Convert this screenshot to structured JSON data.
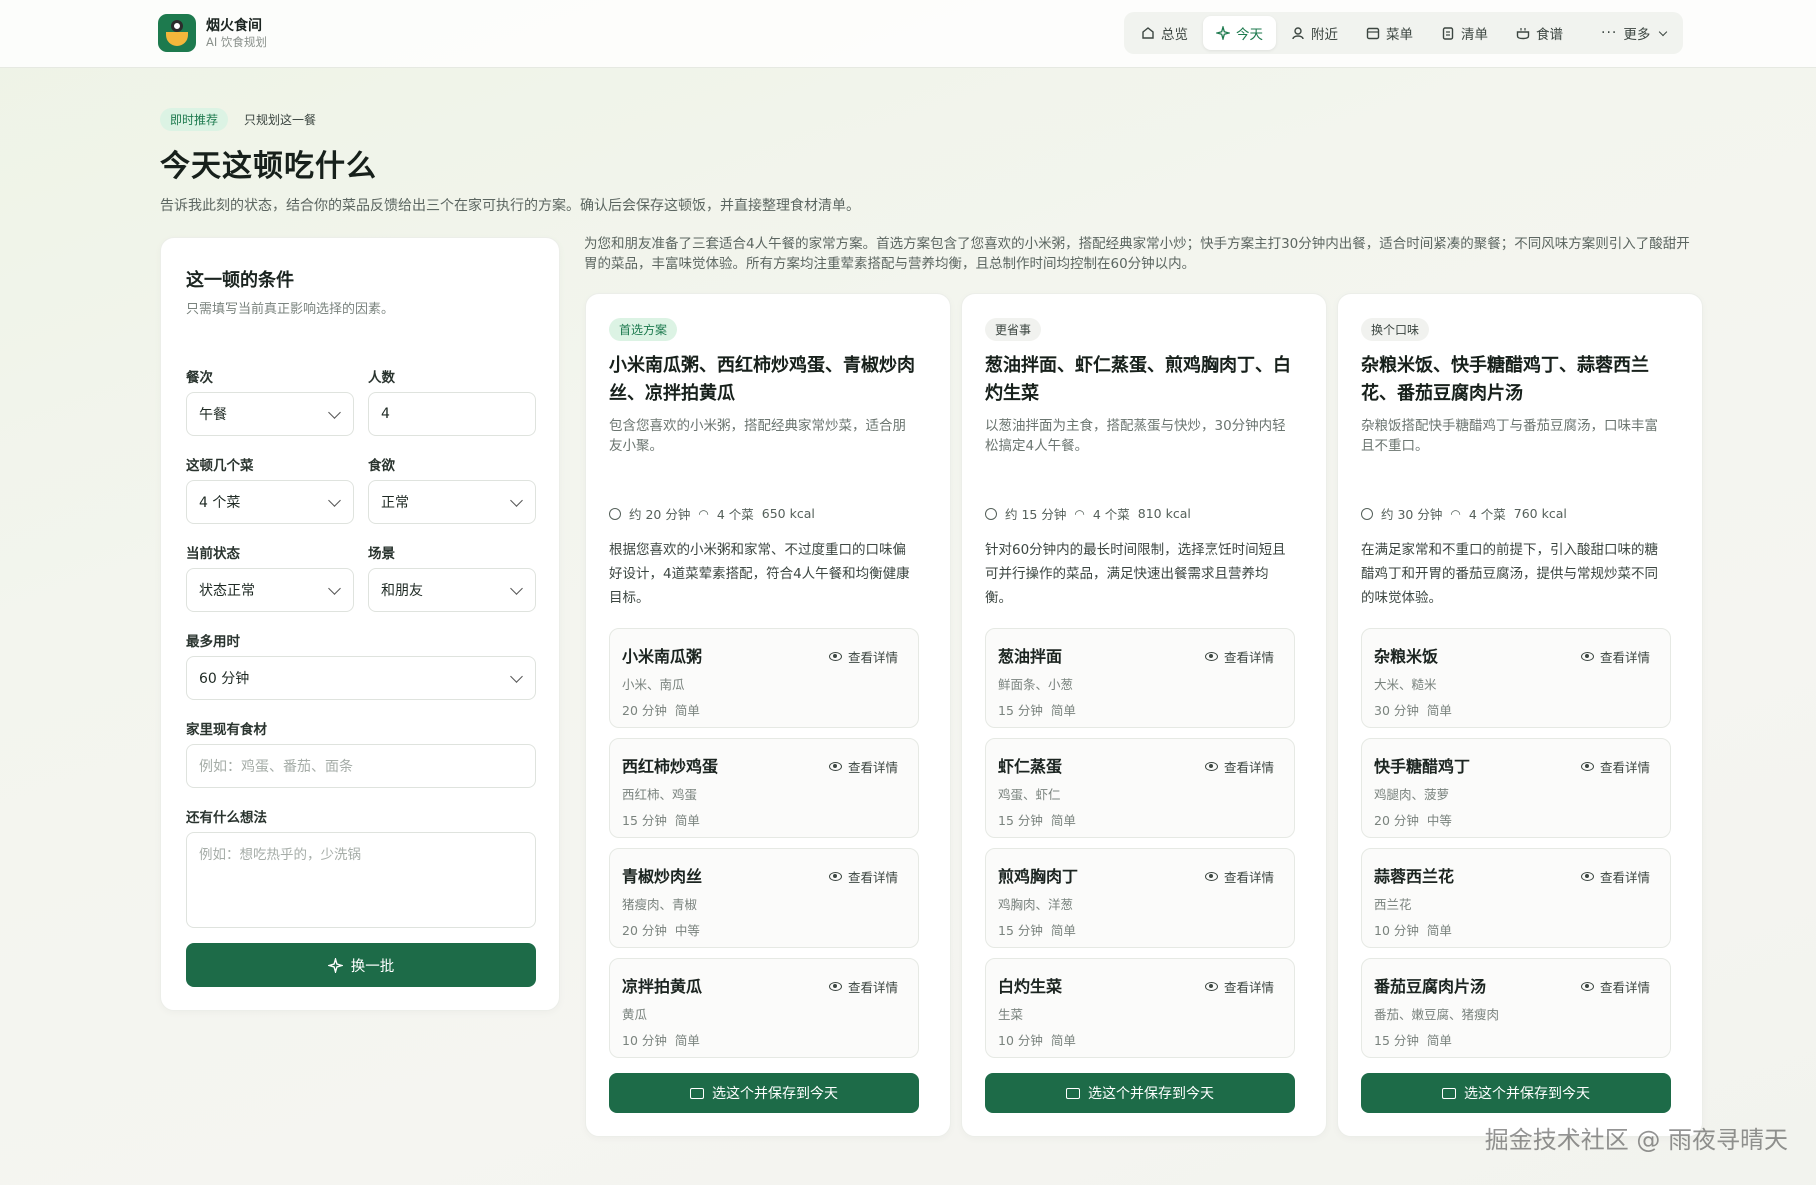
{
  "brand": {
    "name": "烟火食间",
    "sub": "AI 饮食规划"
  },
  "nav": [
    {
      "label": "总览",
      "icon": "home-icon",
      "active": false
    },
    {
      "label": "今天",
      "icon": "sparkle-icon",
      "active": true
    },
    {
      "label": "附近",
      "icon": "person-icon",
      "active": false
    },
    {
      "label": "菜单",
      "icon": "calendar-icon",
      "active": false
    },
    {
      "label": "清单",
      "icon": "clipboard-icon",
      "active": false
    },
    {
      "label": "食谱",
      "icon": "cookpot-icon",
      "active": false
    },
    {
      "label": "更多",
      "icon": "more-icon",
      "active": false
    }
  ],
  "hero": {
    "tag": "即时推荐",
    "tag2": "只规划这一餐",
    "title": "今天这顿吃什么",
    "desc": "告诉我此刻的状态，结合你的菜品反馈给出三个在家可执行的方案。确认后会保存这顿饭，并直接整理食材清单。"
  },
  "conditions": {
    "title": "这一顿的条件",
    "sub": "只需填写当前真正影响选择的因素。",
    "meal_label": "餐次",
    "meal_value": "午餐",
    "people_label": "人数",
    "people_value": "4",
    "dishes_label": "这顿几个菜",
    "dishes_value": "4 个菜",
    "appetite_label": "食欲",
    "appetite_value": "正常",
    "state_label": "当前状态",
    "state_value": "状态正常",
    "scene_label": "场景",
    "scene_value": "和朋友",
    "time_label": "最多用时",
    "time_value": "60 分钟",
    "ingredients_label": "家里现有食材",
    "ingredients_placeholder": "例如：鸡蛋、番茄、面条",
    "ideas_label": "还有什么想法",
    "ideas_placeholder": "例如：想吃热乎的，少洗锅",
    "refresh_button": "换一批"
  },
  "summary": "为您和朋友准备了三套适合4人午餐的家常方案。首选方案包含了您喜欢的小米粥，搭配经典家常小炒；快手方案主打30分钟内出餐，适合时间紧凑的聚餐；不同风味方案则引入了酸甜开胃的菜品，丰富味觉体验。所有方案均注重荤素搭配与营养均衡，且总制作时间均控制在60分钟以内。",
  "plans": [
    {
      "tag": "首选方案",
      "title": "小米南瓜粥、西红柿炒鸡蛋、青椒炒肉丝、凉拌拍黄瓜",
      "desc": "包含您喜欢的小米粥，搭配经典家常炒菜，适合朋友小聚。",
      "time": "约 20 分钟",
      "count": "4 个菜",
      "kcal": "650 kcal",
      "reason": "根据您喜欢的小米粥和家常、不过度重口的口味偏好设计，4道菜荤素搭配，符合4人午餐和均衡健康目标。",
      "dishes": [
        {
          "name": "小米南瓜粥",
          "ing": "小米、南瓜",
          "time": "20 分钟",
          "level": "简单"
        },
        {
          "name": "西红柿炒鸡蛋",
          "ing": "西红柿、鸡蛋",
          "time": "15 分钟",
          "level": "简单"
        },
        {
          "name": "青椒炒肉丝",
          "ing": "猪瘦肉、青椒",
          "time": "20 分钟",
          "level": "中等"
        },
        {
          "name": "凉拌拍黄瓜",
          "ing": "黄瓜",
          "time": "10 分钟",
          "level": "简单"
        }
      ],
      "detail": "查看详情",
      "button": "选这个并保存到今天"
    },
    {
      "tag": "更省事",
      "title": "葱油拌面、虾仁蒸蛋、煎鸡胸肉丁、白灼生菜",
      "desc": "以葱油拌面为主食，搭配蒸蛋与快炒，30分钟内轻松搞定4人午餐。",
      "time": "约 15 分钟",
      "count": "4 个菜",
      "kcal": "810 kcal",
      "reason": "针对60分钟内的最长时间限制，选择烹饪时间短且可并行操作的菜品，满足快速出餐需求且营养均衡。",
      "dishes": [
        {
          "name": "葱油拌面",
          "ing": "鲜面条、小葱",
          "time": "15 分钟",
          "level": "简单"
        },
        {
          "name": "虾仁蒸蛋",
          "ing": "鸡蛋、虾仁",
          "time": "15 分钟",
          "level": "简单"
        },
        {
          "name": "煎鸡胸肉丁",
          "ing": "鸡胸肉、洋葱",
          "time": "15 分钟",
          "level": "简单"
        },
        {
          "name": "白灼生菜",
          "ing": "生菜",
          "time": "10 分钟",
          "level": "简单"
        }
      ],
      "detail": "查看详情",
      "button": "选这个并保存到今天"
    },
    {
      "tag": "换个口味",
      "title": "杂粮米饭、快手糖醋鸡丁、蒜蓉西兰花、番茄豆腐肉片汤",
      "desc": "杂粮饭搭配快手糖醋鸡丁与番茄豆腐汤，口味丰富且不重口。",
      "time": "约 30 分钟",
      "count": "4 个菜",
      "kcal": "760 kcal",
      "reason": "在满足家常和不重口的前提下，引入酸甜口味的糖醋鸡丁和开胃的番茄豆腐汤，提供与常规炒菜不同的味觉体验。",
      "dishes": [
        {
          "name": "杂粮米饭",
          "ing": "大米、糙米",
          "time": "30 分钟",
          "level": "简单"
        },
        {
          "name": "快手糖醋鸡丁",
          "ing": "鸡腿肉、菠萝",
          "time": "20 分钟",
          "level": "中等"
        },
        {
          "name": "蒜蓉西兰花",
          "ing": "西兰花",
          "time": "10 分钟",
          "level": "简单"
        },
        {
          "name": "番茄豆腐肉片汤",
          "ing": "番茄、嫩豆腐、猪瘦肉",
          "time": "15 分钟",
          "level": "简单"
        }
      ],
      "detail": "查看详情",
      "button": "选这个并保存到今天"
    }
  ],
  "watermark": "掘金技术社区 @ 雨夜寻晴天",
  "colors": {
    "accent": "#1d7a4e",
    "button": "#1d6b48",
    "tag_bg": "#dcf3e4"
  }
}
